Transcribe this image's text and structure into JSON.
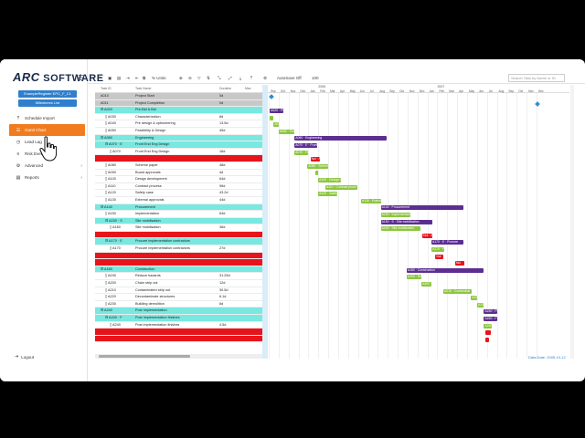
{
  "brand": {
    "prefix": "ARC",
    "name": "SOFTWARE"
  },
  "project": {
    "name": "ExampleRegister EPC_F_C1",
    "milestones": "Milestones List"
  },
  "nav": [
    {
      "label": "Schedule Import",
      "icon": "upload-icon"
    },
    {
      "label": "Gantt Chart",
      "icon": "gantt-icon",
      "active": true
    },
    {
      "label": "Lead Lag",
      "icon": "clock-icon"
    },
    {
      "label": "Risk Events",
      "icon": "list-icon"
    },
    {
      "label": "Advanced",
      "icon": "gear-icon",
      "expandable": true
    },
    {
      "label": "Reports",
      "icon": "report-icon",
      "expandable": true
    }
  ],
  "logout": "Logout",
  "toolbar": {
    "zoom": "% Units",
    "auto_save": "AutoSave Off",
    "zoom_level": "100",
    "search_placeholder": "Search Task by Name or ID"
  },
  "table_headers": {
    "id": "Task ID",
    "name": "Task Name",
    "duration": "Duration",
    "extra": "Max"
  },
  "rows": [
    {
      "type": "milestone",
      "indent": 0,
      "id": "A010",
      "name": "Project Start",
      "dur": "0d"
    },
    {
      "type": "milestone",
      "indent": 0,
      "id": "A011",
      "name": "Project Completion",
      "dur": "0d"
    },
    {
      "type": "summary",
      "indent": 0,
      "id": "A020",
      "name": "Pre-Bid & Bid",
      "dur": ""
    },
    {
      "type": "task",
      "indent": 1,
      "id": "A030",
      "name": "Characterization",
      "dur": "8d"
    },
    {
      "type": "task",
      "indent": 1,
      "id": "A040",
      "name": "Pre design & optioneering",
      "dur": "13.5d"
    },
    {
      "type": "task",
      "indent": 1,
      "id": "A050",
      "name": "Feasibility & Design",
      "dur": "45d"
    },
    {
      "type": "summary",
      "indent": 0,
      "id": "A060",
      "name": "Engineering",
      "dur": ""
    },
    {
      "type": "summary",
      "indent": 1,
      "id": "A070 · E",
      "name": "Front End Eng Design",
      "dur": ""
    },
    {
      "type": "task",
      "indent": 2,
      "id": "A070",
      "name": "Front End Eng Design",
      "dur": "16d"
    },
    {
      "type": "critical",
      "indent": 2,
      "id": "",
      "name": "",
      "dur": ""
    },
    {
      "type": "task",
      "indent": 1,
      "id": "A080",
      "name": "Scheme paper",
      "dur": "48d"
    },
    {
      "type": "task",
      "indent": 1,
      "id": "A090",
      "name": "Board approvals",
      "dur": "4d"
    },
    {
      "type": "task",
      "indent": 1,
      "id": "A100",
      "name": "Design development",
      "dur": "64d"
    },
    {
      "type": "task",
      "indent": 1,
      "id": "A110",
      "name": "Contract process",
      "dur": "96d"
    },
    {
      "type": "task",
      "indent": 1,
      "id": "A120",
      "name": "Safety case",
      "dur": "43.2d"
    },
    {
      "type": "task",
      "indent": 1,
      "id": "A130",
      "name": "External approvals",
      "dur": "44d"
    },
    {
      "type": "summary",
      "indent": 0,
      "id": "A140",
      "name": "Procurement",
      "dur": ""
    },
    {
      "type": "task",
      "indent": 1,
      "id": "A150",
      "name": "Implementation",
      "dur": "64d"
    },
    {
      "type": "summary",
      "indent": 1,
      "id": "A150 · S",
      "name": "Site mobilisation",
      "dur": ""
    },
    {
      "type": "task",
      "indent": 2,
      "id": "A160",
      "name": "Site mobilisation",
      "dur": "36d"
    },
    {
      "type": "critical",
      "indent": 2,
      "id": "",
      "name": "",
      "dur": ""
    },
    {
      "type": "summary",
      "indent": 1,
      "id": "A170 · E",
      "name": "Procure implementation contractors",
      "dur": ""
    },
    {
      "type": "task",
      "indent": 2,
      "id": "A170",
      "name": "Procure implementation contractors",
      "dur": "27d"
    },
    {
      "type": "critical",
      "indent": 2,
      "id": "",
      "name": "",
      "dur": ""
    },
    {
      "type": "critical",
      "indent": 2,
      "id": "",
      "name": "",
      "dur": ""
    },
    {
      "type": "summary",
      "indent": 0,
      "id": "A180",
      "name": "Construction",
      "dur": ""
    },
    {
      "type": "task",
      "indent": 1,
      "id": "A190",
      "name": "Reduce hazards",
      "dur": "31.25d"
    },
    {
      "type": "task",
      "indent": 1,
      "id": "A200",
      "name": "Chain strip out",
      "dur": "12d"
    },
    {
      "type": "task",
      "indent": 1,
      "id": "A210",
      "name": "Contaminated strip out",
      "dur": "30.5d"
    },
    {
      "type": "task",
      "indent": 1,
      "id": "A220",
      "name": "Decontaminate structures",
      "dur": "6.1d"
    },
    {
      "type": "task",
      "indent": 1,
      "id": "A230",
      "name": "Building demolition",
      "dur": "6d"
    },
    {
      "type": "summary",
      "indent": 0,
      "id": "A240",
      "name": "Post Implementation",
      "dur": ""
    },
    {
      "type": "summary",
      "indent": 1,
      "id": "A240 · F",
      "name": "Post Implementation finishes",
      "dur": ""
    },
    {
      "type": "task",
      "indent": 2,
      "id": "A240",
      "name": "Post implementation finishes",
      "dur": "4.5d"
    },
    {
      "type": "critical",
      "indent": 2,
      "id": "",
      "name": "",
      "dur": ""
    },
    {
      "type": "critical",
      "indent": 2,
      "id": "",
      "name": "",
      "dur": ""
    }
  ],
  "gantt": {
    "years": [
      {
        "label": "2006",
        "m": 1
      },
      {
        "label": "2007",
        "m": 13
      }
    ],
    "months": [
      "Sep",
      "Oct",
      "Nov",
      "Dec",
      "Jan",
      "Feb",
      "Mar",
      "Apr",
      "May",
      "Jun",
      "Jul",
      "Aug",
      "Sep",
      "Oct",
      "Nov",
      "Dec",
      "Jan",
      "Feb",
      "Mar",
      "Apr",
      "May",
      "Jun",
      "Jul",
      "Aug",
      "Sep",
      "Oct",
      "Nov",
      "Dec"
    ],
    "bars": [
      {
        "row": 0,
        "kind": "diamond",
        "start": 0.1
      },
      {
        "row": 1,
        "kind": "diamond",
        "start": 26.9
      },
      {
        "row": 2,
        "kind": "purple",
        "start": 0.1,
        "end": 1.5,
        "label": "A020 · Pre-Bid &"
      },
      {
        "row": 3,
        "kind": "green",
        "start": 0.1,
        "end": 0.5,
        "label": ""
      },
      {
        "row": 4,
        "kind": "green",
        "start": 0.5,
        "end": 1.0,
        "label": "A040"
      },
      {
        "row": 5,
        "kind": "green",
        "start": 1.0,
        "end": 2.6,
        "label": "A050 · Feasib"
      },
      {
        "row": 6,
        "kind": "purple",
        "start": 2.6,
        "end": 11.9,
        "label": "A060 · Engineering"
      },
      {
        "row": 7,
        "kind": "purple",
        "start": 2.6,
        "end": 4.9,
        "label": "A070 · E · Front En"
      },
      {
        "row": 8,
        "kind": "green",
        "start": 2.6,
        "end": 4.0,
        "label": "A070 · Fron"
      },
      {
        "row": 9,
        "kind": "red",
        "start": 4.2,
        "end": 5.2,
        "label": "Nul · A"
      },
      {
        "row": 10,
        "kind": "green",
        "start": 3.9,
        "end": 6.0,
        "label": "A080 · Schem"
      },
      {
        "row": 11,
        "kind": "green",
        "start": 4.7,
        "end": 5.0,
        "label": ""
      },
      {
        "row": 12,
        "kind": "green",
        "start": 5.0,
        "end": 7.3,
        "label": "A100 · Design develo"
      },
      {
        "row": 13,
        "kind": "green",
        "start": 5.7,
        "end": 8.9,
        "label": "A110 · Contract proce"
      },
      {
        "row": 14,
        "kind": "green",
        "start": 5.0,
        "end": 6.9,
        "label": "A120 · Safety"
      },
      {
        "row": 15,
        "kind": "green",
        "start": 9.3,
        "end": 11.3,
        "label": "A130 · Externa"
      },
      {
        "row": 16,
        "kind": "purple",
        "start": 11.3,
        "end": 19.6,
        "label": "A140 · Procurement"
      },
      {
        "row": 17,
        "kind": "green",
        "start": 11.3,
        "end": 14.3,
        "label": "A150 · Implementation"
      },
      {
        "row": 18,
        "kind": "purple",
        "start": 11.3,
        "end": 16.5,
        "label": "A150 · S · Site mobilisation"
      },
      {
        "row": 19,
        "kind": "green",
        "start": 11.3,
        "end": 15.3,
        "label": "A160 · Site mobilisation"
      },
      {
        "row": 20,
        "kind": "red",
        "start": 15.5,
        "end": 16.5,
        "label": "Nul · A"
      },
      {
        "row": 21,
        "kind": "purple",
        "start": 16.4,
        "end": 19.6,
        "label": "A170 · E · Procure"
      },
      {
        "row": 22,
        "kind": "green",
        "start": 16.4,
        "end": 17.7,
        "label": "A170 · P"
      },
      {
        "row": 23,
        "kind": "red",
        "start": 16.8,
        "end": 17.6,
        "label": "Nul"
      },
      {
        "row": 24,
        "kind": "red",
        "start": 18.8,
        "end": 19.7,
        "label": "Nul"
      },
      {
        "row": 25,
        "kind": "purple",
        "start": 13.9,
        "end": 21.7,
        "label": "A180 · Construction"
      },
      {
        "row": 26,
        "kind": "green",
        "start": 13.9,
        "end": 15.4,
        "label": "A190 · Red"
      },
      {
        "row": 27,
        "kind": "green",
        "start": 15.4,
        "end": 16.4,
        "label": "A200 · Ch"
      },
      {
        "row": 28,
        "kind": "green",
        "start": 17.6,
        "end": 20.5,
        "label": "A210 · Contaminat"
      },
      {
        "row": 29,
        "kind": "green",
        "start": 20.4,
        "end": 21.0,
        "label": "A220"
      },
      {
        "row": 30,
        "kind": "green",
        "start": 21.0,
        "end": 21.7,
        "label": "A230"
      },
      {
        "row": 31,
        "kind": "purple",
        "start": 21.7,
        "end": 23.0,
        "label": "A240 · Pos"
      },
      {
        "row": 32,
        "kind": "purple",
        "start": 21.7,
        "end": 23.0,
        "label": "A240 · F · Pos"
      },
      {
        "row": 33,
        "kind": "green",
        "start": 21.7,
        "end": 22.5,
        "label": "A240"
      },
      {
        "row": 34,
        "kind": "red",
        "start": 21.8,
        "end": 22.4,
        "label": ""
      },
      {
        "row": 35,
        "kind": "red",
        "start": 21.8,
        "end": 22.2,
        "label": ""
      }
    ]
  },
  "footer": {
    "label": "Data Date",
    "value": "2005-10-12"
  },
  "colors": {
    "accent": "#f07c1f",
    "primary": "#2f7fce",
    "summary": "#5c2e91",
    "task": "#8cc63f",
    "critical": "#e8141c"
  }
}
